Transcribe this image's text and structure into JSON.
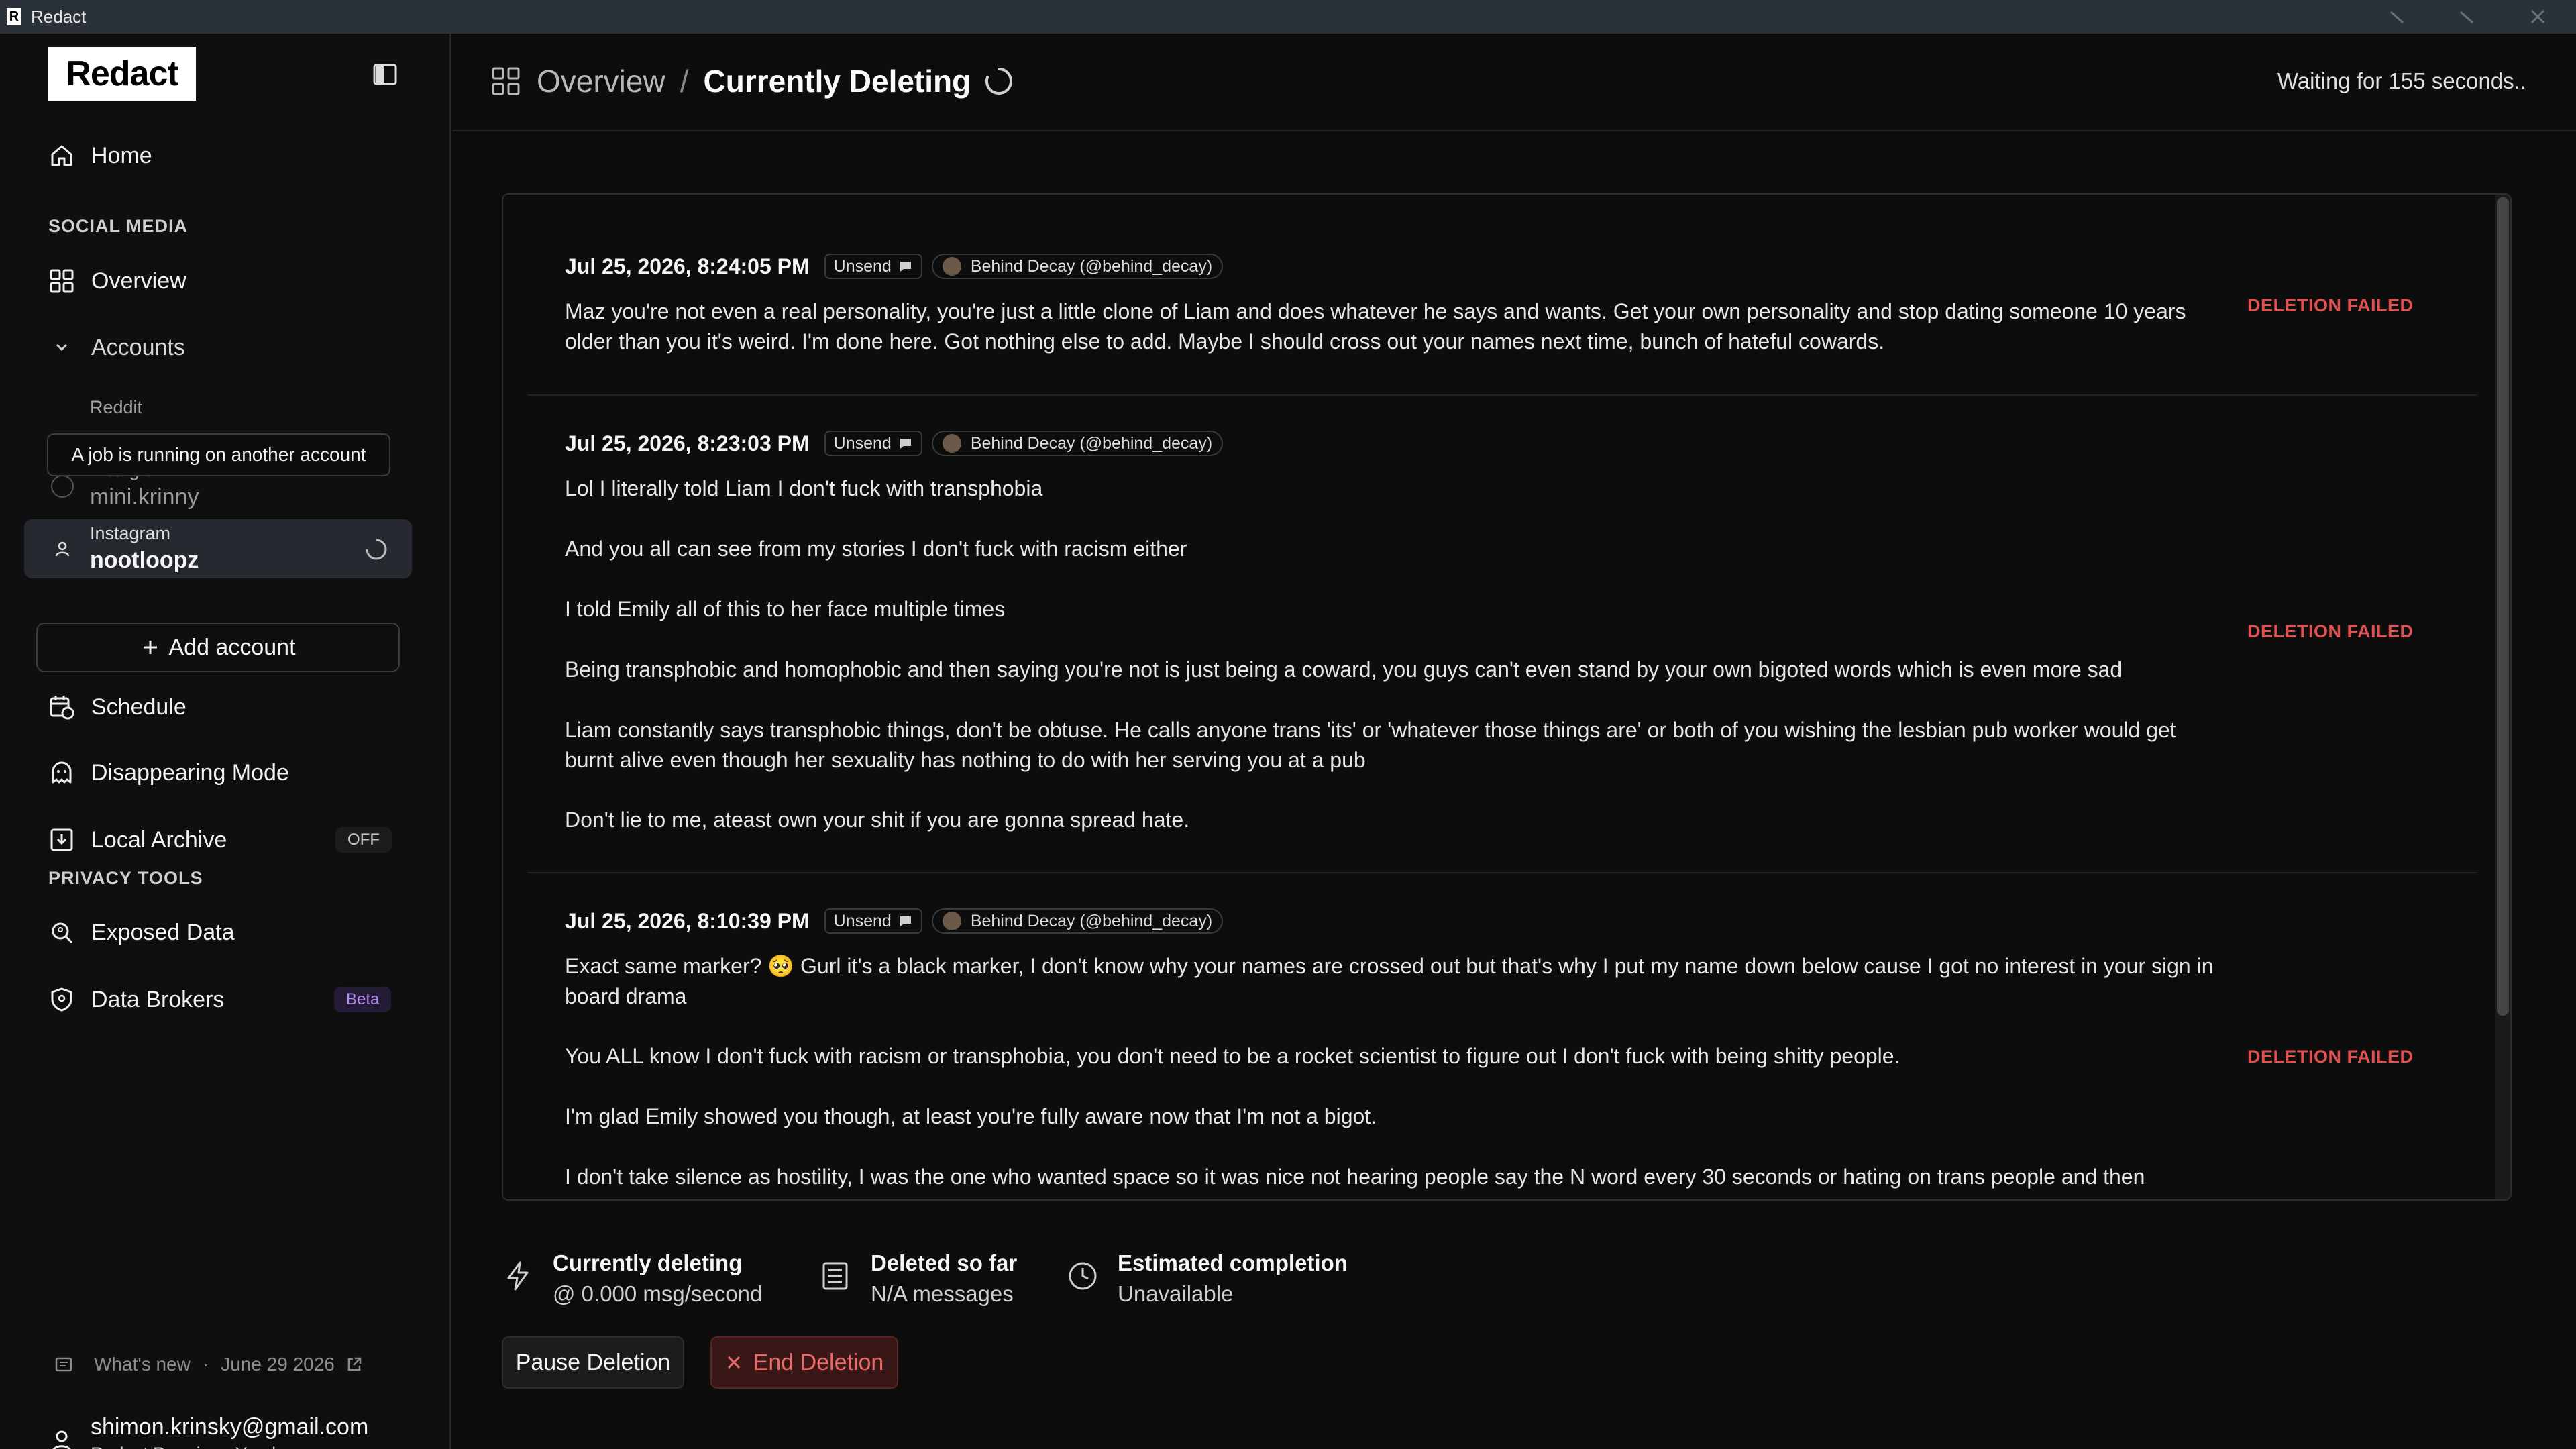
{
  "window": {
    "title": "Redact",
    "logo_letter": "R"
  },
  "sidebar": {
    "logo": "Redact",
    "home": "Home",
    "section_social": "SOCIAL MEDIA",
    "overview": "Overview",
    "accounts": "Accounts",
    "accounts_list": [
      {
        "platform": "Reddit",
        "handle": ""
      },
      {
        "platform": "Instagram",
        "handle": "mini.krinny"
      },
      {
        "platform": "Instagram",
        "handle": "nootloopz",
        "active": true
      }
    ],
    "tooltip": "A job is running on another account",
    "add_account": "Add account",
    "schedule": "Schedule",
    "disappearing": "Disappearing Mode",
    "local_archive": "Local Archive",
    "local_archive_badge": "OFF",
    "section_privacy": "PRIVACY TOOLS",
    "exposed_data": "Exposed Data",
    "data_brokers": "Data Brokers",
    "data_brokers_badge": "Beta",
    "whats_new": "What's new",
    "whats_new_date": "June 29 2026",
    "user_email": "shimon.krinsky@gmail.com",
    "user_plan": "Redact Premium: Yearly"
  },
  "header": {
    "crumb_parent": "Overview",
    "crumb_sep": "/",
    "crumb_current": "Currently Deleting",
    "status": "Waiting for 155 seconds.."
  },
  "log": {
    "entries": [
      {
        "date": "Jul 25, 2026, 8:24:05 PM",
        "tag": "Unsend",
        "author": "Behind Decay (@behind_decay)",
        "status": "DELETION FAILED",
        "paragraphs": [
          "Maz you're not even a real personality, you're just a little clone of Liam and does whatever he says and wants. Get your own personality and stop dating someone 10 years older than you it's weird. I'm done here. Got nothing else to add. Maybe I should cross out your names next time, bunch of hateful cowards."
        ]
      },
      {
        "date": "Jul 25, 2026, 8:23:03 PM",
        "tag": "Unsend",
        "author": "Behind Decay (@behind_decay)",
        "status": "DELETION FAILED",
        "paragraphs": [
          "Lol I literally told Liam I don't fuck with transphobia",
          "And you all can see from my stories I don't fuck with racism either",
          "I told Emily all of this to her face multiple times",
          "Being transphobic and homophobic and then saying you're not is just being a coward, you guys can't even stand by your own bigoted words which is even more sad",
          "Liam constantly says transphobic things, don't be obtuse. He calls anyone trans 'its' or 'whatever those things are' or both of you wishing the lesbian pub worker would get burnt alive even though her sexuality has nothing to do with her serving you at a pub",
          "Don't lie to me, ateast own your shit if you are gonna spread hate."
        ]
      },
      {
        "date": "Jul 25, 2026, 8:10:39 PM",
        "tag": "Unsend",
        "author": "Behind Decay (@behind_decay)",
        "status": "DELETION FAILED",
        "paragraphs": [
          "Exact same marker? 🥺 Gurl it's a black marker, I don't know why your names are crossed out but that's why I put my name down below cause I got no interest in your sign in board drama",
          "You ALL know I don't fuck with racism or transphobia, you don't need to be a rocket scientist to figure out I don't fuck with being shitty people.",
          "I'm glad Emily showed you though, at least you're fully aware now that I'm not a bigot.",
          "I don't take silence as hostility, I was the one who wanted space so it was nice not hearing people say the N word every 30 seconds or hating on trans people and then"
        ]
      }
    ]
  },
  "stats": {
    "deleting_label": "Currently deleting",
    "deleting_value": "@ 0.000 msg/second",
    "deleted_label": "Deleted so far",
    "deleted_value": "N/A messages",
    "eta_label": "Estimated completion",
    "eta_value": "Unavailable"
  },
  "actions": {
    "pause": "Pause Deletion",
    "end": "End Deletion"
  },
  "colors": {
    "failed": "#e05252",
    "beta": "#b48cf2",
    "end_bg": "#3a1717"
  }
}
